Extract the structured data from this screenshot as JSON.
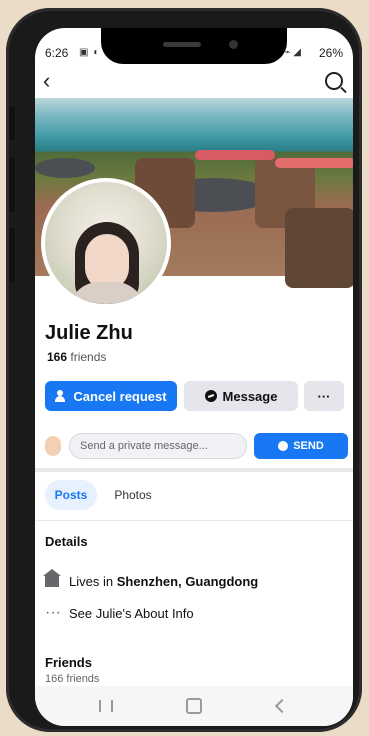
{
  "status": {
    "time": "6:26",
    "system_icons": "▣ ◐",
    "signal_icons": "⌁ ◢",
    "battery_text": "26%"
  },
  "topbar": {
    "back_icon": "back-arrow-icon",
    "search_icon": "search-icon"
  },
  "profile": {
    "name": "Julie Zhu",
    "friends_count": "166",
    "friends_label": "friends"
  },
  "actions": {
    "cancel_request": "Cancel request",
    "message": "Message",
    "more": "···"
  },
  "private_message": {
    "placeholder": "Send a private message...",
    "send_label": "SEND"
  },
  "tabs": [
    {
      "label": "Posts",
      "active": true
    },
    {
      "label": "Photos",
      "active": false
    }
  ],
  "details": {
    "title": "Details",
    "lives_prefix": "Lives in ",
    "lives_place": "Shenzhen, Guangdong",
    "about_link": "See Julie's About Info"
  },
  "friends_section": {
    "title": "Friends",
    "count_text": "166 friends"
  },
  "colors": {
    "accent": "#1877f2",
    "button_secondary": "#e4e6eb",
    "text": "#111111"
  }
}
